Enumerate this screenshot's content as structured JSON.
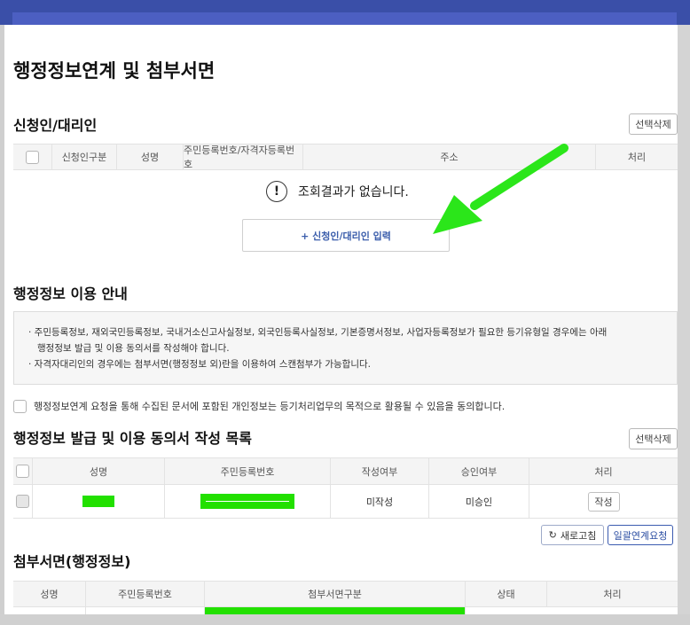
{
  "page_title": "행정정보연계 및 첨부서면",
  "applicant": {
    "title": "신청인/대리인",
    "delete_label": "선택삭제",
    "columns": [
      "신청인구분",
      "성명",
      "주민등록번호/자격자등록번호",
      "주소",
      "처리"
    ],
    "empty_message": "조회결과가 없습니다.",
    "add_label": "+ 신청인/대리인 입력"
  },
  "guide": {
    "title": "행정정보 이용 안내",
    "lines": [
      "· 주민등록정보, 재외국민등록정보, 국내거소신고사실정보, 외국인등록사실정보, 기본증명서정보, 사업자등록정보가 필요한 등기유형일 경우에는 아래",
      "행정정보 발급 및 이용 동의서를 작성해야 합니다.",
      "· 자격자대리인의 경우에는 첨부서면(행정정보 외)란을 이용하여 스캔첨부가 가능합니다."
    ]
  },
  "consent": {
    "label": "행정정보연계 요청을 통해 수집된 문서에 포함된 개인정보는 등기처리업무의 목적으로 활용될 수 있음을 동의합니다."
  },
  "consent_list": {
    "title": "행정정보 발급 및 이용 동의서 작성 목록",
    "delete_label": "선택삭제",
    "columns": [
      "성명",
      "주민등록번호",
      "작성여부",
      "승인여부",
      "처리"
    ],
    "rows": [
      {
        "status": "미작성",
        "approval": "미승인",
        "action": "작성"
      }
    ]
  },
  "attachments": {
    "title": "첨부서면(행정정보)",
    "refresh_label": "새로고침",
    "batch_label": "일괄연계요청",
    "columns": [
      "성명",
      "주민등록번호",
      "첨부서면구분",
      "상태",
      "처리"
    ]
  },
  "colors": {
    "header": "#3a4fa8",
    "accent": "#3a5dab",
    "redaction": "#22e000",
    "arrow": "#2be61a"
  }
}
